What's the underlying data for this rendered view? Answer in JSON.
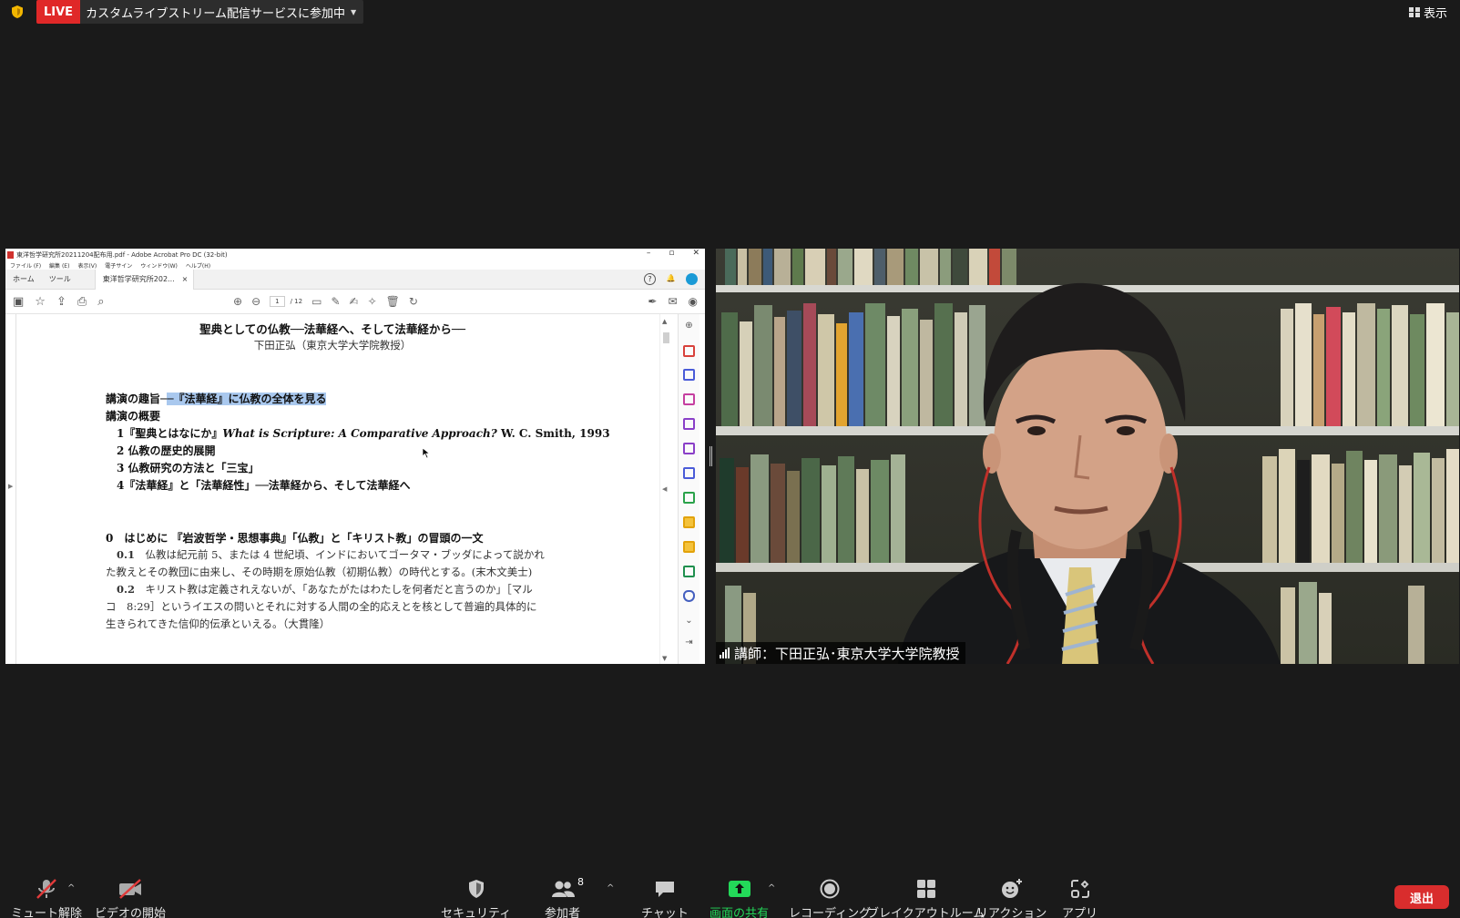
{
  "top": {
    "live_badge": "LIVE",
    "live_text": "カスタムライブストリーム配信サービスに参加中",
    "view_label": "表示"
  },
  "acrobat": {
    "window_title": "東洋哲学研究所20211204配布用.pdf - Adobe Acrobat Pro DC (32-bit)",
    "menu": [
      "ファイル (F)",
      "編集 (E)",
      "表示(V)",
      "電子サイン",
      "ウィンドウ(W)",
      "ヘルプ(H)"
    ],
    "tabs": {
      "home": "ホーム",
      "tools": "ツール",
      "doc": "東洋哲学研究所202..."
    },
    "page_current": "1",
    "page_total": "/ 12"
  },
  "document": {
    "title": "聖典としての仏教──法華経へ、そして法華経から──",
    "author": "下田正弘（東京大学大学院教授）",
    "purpose_prefix": "講演の趣旨─",
    "purpose_highlight": "─『法華経』に仏教の全体を見る",
    "outline_heading": "講演の概要",
    "outline_1_a": "1『聖典とはなにか』",
    "outline_1_b": "What is Scripture: A Comparative Approach?",
    "outline_1_c": " W. C. Smith, 1993",
    "outline_2": "2  仏教の歴史的展開",
    "outline_3": "3  仏教研究の方法と「三宝」",
    "outline_4": "4『法華経』と「法華経性」──法華経から、そして法華経へ",
    "section_0": "0　はじめに 『岩波哲学・思想事典』「仏教」と「キリスト教」の冒頭の一文",
    "p01_num": "0.1",
    "p01_line1": "　仏教は紀元前 5、または 4 世紀頃、インドにおいてゴータマ・ブッダによって説かれ",
    "p01_line2": "た教えとその教団に由来し、その時期を原始仏教（初期仏教）の時代とする。(末木文美士)",
    "p02_num": "0.2",
    "p02_line1": "　キリスト教は定義されえないが、「あなたがたはわたしを何者だと言うのか」［マル",
    "p02_line2": "コ　8:29］というイエスの問いとそれに対する人間の全的応えとを核として普遍的具体的に",
    "p02_line3": "生きられてきた信仰的伝承といえる。（大貫隆）"
  },
  "video": {
    "name_tag": "講師：下田正弘･東京大学大学院教授"
  },
  "toolbar": {
    "unmute": "ミュート解除",
    "start_video": "ビデオの開始",
    "security": "セキュリティ",
    "participants": "参加者",
    "participants_count": "8",
    "chat": "チャット",
    "share": "画面の共有",
    "recording": "レコーディング",
    "breakout": "ブレイクアウトルーム",
    "reactions": "リアクション",
    "apps": "アプリ",
    "leave": "退出"
  },
  "colors": {
    "live_red": "#e02828",
    "share_green": "#23d959",
    "leave_red": "#d92d2d",
    "highlight": "#a9c8ee"
  }
}
